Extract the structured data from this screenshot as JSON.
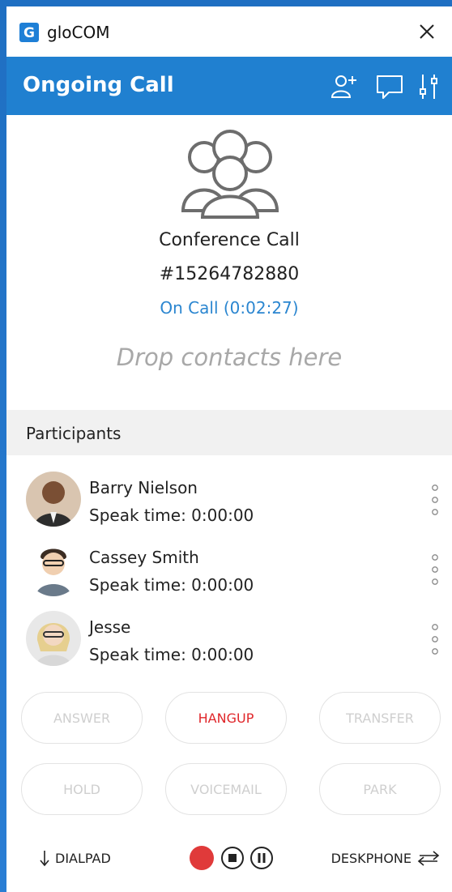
{
  "app": {
    "name": "gloCOM",
    "logo_letter": "G"
  },
  "header": {
    "title": "Ongoing Call"
  },
  "call": {
    "name": "Conference Call",
    "number": "#15264782880",
    "status": "On Call (0:02:27)",
    "drop_hint": "Drop contacts here"
  },
  "participants": {
    "label": "Participants",
    "items": [
      {
        "name": "Barry Nielson",
        "speak_time": "Speak time: 0:00:00"
      },
      {
        "name": "Cassey Smith",
        "speak_time": "Speak time: 0:00:00"
      },
      {
        "name": "Jesse",
        "speak_time": "Speak time: 0:00:00"
      }
    ]
  },
  "actions": {
    "answer": "ANSWER",
    "hangup": "HANGUP",
    "transfer": "TRANSFER",
    "hold": "HOLD",
    "voicemail": "VOICEMAIL",
    "park": "PARK"
  },
  "bottom": {
    "dialpad": "DIALPAD",
    "deskphone": "DESKPHONE"
  },
  "colors": {
    "header_bg": "#2080d0",
    "status_text": "#2b86d0",
    "hangup_text": "#e0262a",
    "record": "#e03a3a"
  }
}
